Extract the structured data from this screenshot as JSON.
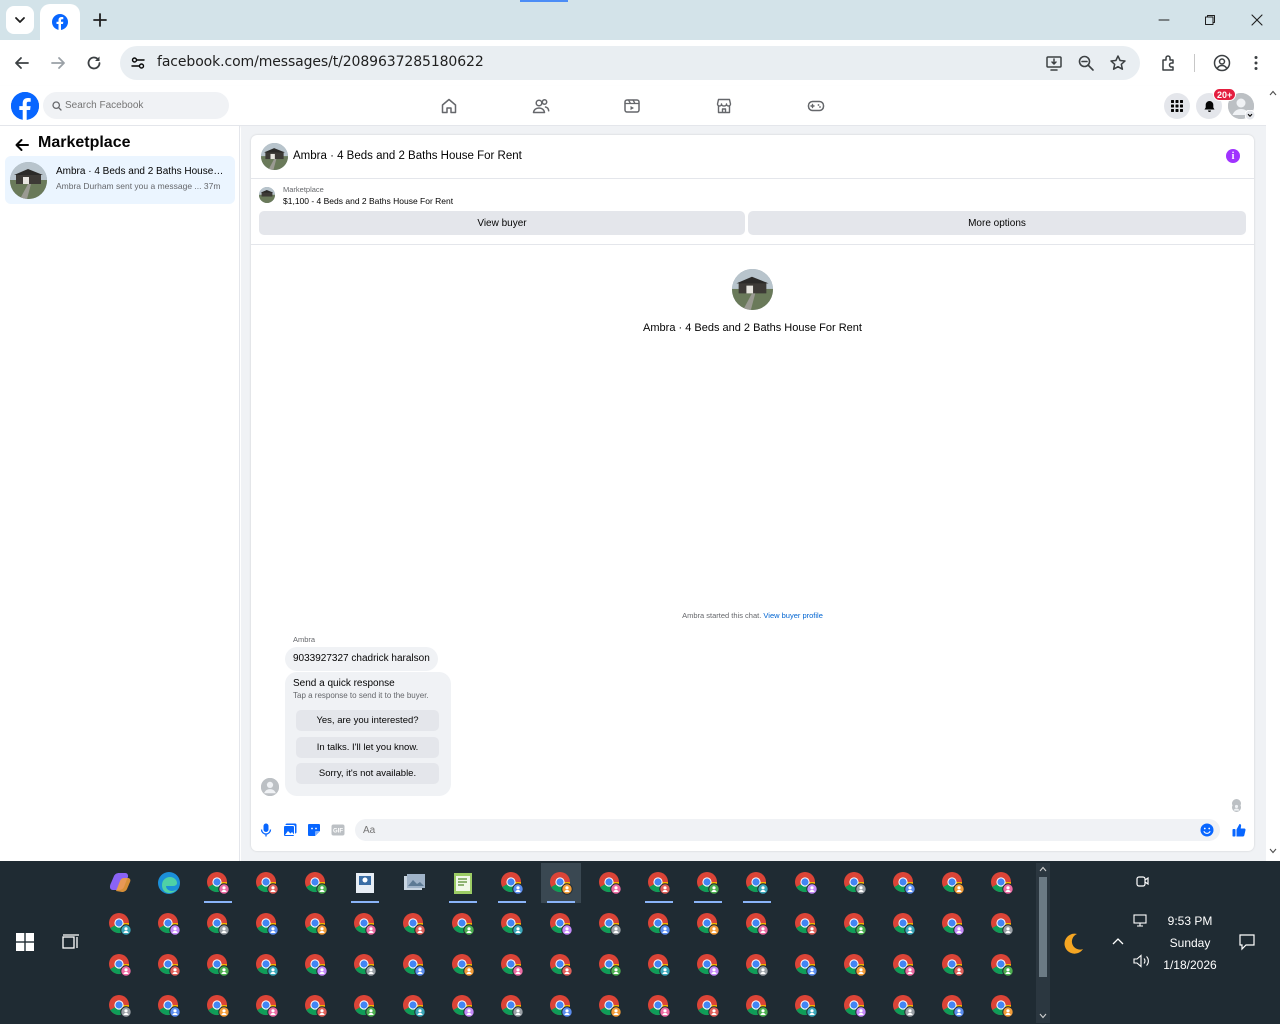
{
  "browser": {
    "url": "facebook.com/messages/t/2089637285180622",
    "tab_title": "Facebook"
  },
  "fb_header": {
    "search_placeholder": "Search Facebook",
    "notification_count": "20+"
  },
  "left_panel": {
    "title": "Marketplace",
    "conversations": [
      {
        "name": "Ambra · 4 Beds and 2 Baths House For Rent",
        "preview": "Ambra Durham sent you a message ... 37m"
      }
    ]
  },
  "chat": {
    "title": "Ambra · 4 Beds and 2 Baths House For Rent",
    "listing_label": "Marketplace",
    "listing_price": "$1,100 - 4 Beds and 2 Baths House For Rent",
    "view_buyer_label": "View buyer",
    "more_options_label": "More options",
    "center_name": "Ambra · 4 Beds and 2 Baths House For Rent",
    "started_text": "Ambra started this chat.",
    "view_profile_link": "View buyer profile",
    "sender_name": "Ambra",
    "message": "9033927327 chadrick haralson",
    "quick_title": "Send a quick response",
    "quick_subtitle": "Tap a response to send it to the buyer.",
    "quick_responses": [
      "Yes, are you interested?",
      "In talks. I'll let you know.",
      "Sorry, it's not available."
    ],
    "composer_placeholder": "Aa"
  },
  "taskbar": {
    "time": "9:53 PM",
    "day": "Sunday",
    "date": "1/18/2026"
  },
  "colors": {
    "fb_blue": "#0866ff",
    "taskbar_bg": "#1f2b33",
    "info_purple": "#a033ff"
  }
}
